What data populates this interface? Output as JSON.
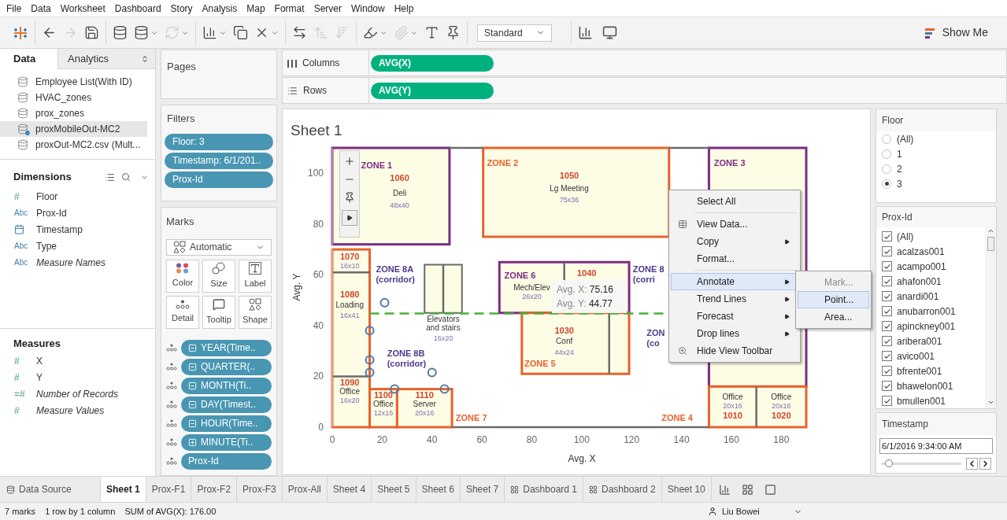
{
  "menu": [
    "File",
    "Data",
    "Worksheet",
    "Dashboard",
    "Story",
    "Analysis",
    "Map",
    "Format",
    "Server",
    "Window",
    "Help"
  ],
  "toolbar": {
    "buttons": [
      {
        "kind": "logo"
      },
      {
        "kind": "back",
        "disabled": false
      },
      {
        "kind": "forward",
        "disabled": true
      },
      {
        "kind": "save",
        "disabled": false
      },
      {
        "kind": "new-source",
        "disabled": false
      },
      {
        "kind": "pause",
        "disabled": false,
        "caret": true
      },
      {
        "kind": "refresh",
        "disabled": true,
        "caret": true
      },
      {
        "kind": "new-sheet",
        "disabled": false,
        "caret": true
      },
      {
        "kind": "duplicate",
        "disabled": false
      },
      {
        "kind": "clear",
        "disabled": false,
        "caret": true
      },
      {
        "kind": "swap",
        "disabled": false
      },
      {
        "kind": "sort-asc",
        "disabled": true
      },
      {
        "kind": "sort-desc",
        "disabled": true
      },
      {
        "kind": "highlight",
        "disabled": false,
        "caret": true
      },
      {
        "kind": "group",
        "disabled": true,
        "caret": true
      },
      {
        "kind": "labels",
        "disabled": false
      },
      {
        "kind": "pin",
        "disabled": false
      }
    ],
    "view_size": "Standard",
    "show_me": "Show Me"
  },
  "data_pane": {
    "tabs": [
      {
        "label": "Data",
        "selected": true
      },
      {
        "label": "Analytics",
        "selected": false
      }
    ],
    "sources": [
      {
        "name": "Employee List(With ID)",
        "selected": false
      },
      {
        "name": "HVAC_zones",
        "selected": false
      },
      {
        "name": "prox_zones",
        "selected": false
      },
      {
        "name": "proxMobileOut-MC2",
        "selected": true
      },
      {
        "name": "proxOut-MC2.csv (Mult...",
        "selected": false
      }
    ],
    "dimensions": {
      "title": "Dimensions",
      "fields": [
        {
          "kind": "number",
          "badge": "#",
          "name": "Floor",
          "generated": false
        },
        {
          "kind": "string",
          "badge": "Abc",
          "name": "Prox-Id",
          "generated": false
        },
        {
          "kind": "date",
          "name": "Timestamp",
          "generated": false
        },
        {
          "kind": "string",
          "badge": "Abc",
          "name": "Type",
          "generated": false
        },
        {
          "kind": "string",
          "badge": "Abc",
          "name": "Measure Names",
          "generated": true
        }
      ]
    },
    "measures": {
      "title": "Measures",
      "fields": [
        {
          "kind": "number",
          "badge": "#",
          "name": "X",
          "generated": false
        },
        {
          "kind": "number",
          "badge": "#",
          "name": "Y",
          "generated": false
        },
        {
          "kind": "number",
          "badge": "=#",
          "name": "Number of Records",
          "generated": true
        },
        {
          "kind": "number",
          "badge": "#",
          "name": "Measure Values",
          "generated": true
        }
      ]
    }
  },
  "pages": {
    "title": "Pages"
  },
  "filters": {
    "title": "Filters",
    "pills": [
      "Floor: 3",
      "Timestamp: 6/1/201..",
      "Prox-Id"
    ]
  },
  "marks": {
    "title": "Marks",
    "mark_type": "Automatic",
    "cards": [
      {
        "kind": "color",
        "label": "Color"
      },
      {
        "kind": "size",
        "label": "Size"
      },
      {
        "kind": "label",
        "label": "Label"
      },
      {
        "kind": "detail",
        "label": "Detail"
      },
      {
        "kind": "tooltip",
        "label": "Tooltip"
      },
      {
        "kind": "shape",
        "label": "Shape"
      }
    ],
    "pills": [
      {
        "label": "YEAR(Time..",
        "expanded": true
      },
      {
        "label": "QUARTER(..",
        "expanded": true
      },
      {
        "label": "MONTH(Ti..",
        "expanded": true
      },
      {
        "label": "DAY(Timest..",
        "expanded": true
      },
      {
        "label": "HOUR(Time..",
        "expanded": true
      },
      {
        "label": "MINUTE(Ti..",
        "expanded": false
      },
      {
        "label": "Prox-Id"
      }
    ]
  },
  "shelves": [
    {
      "kind": "columns",
      "label": "Columns",
      "pills": [
        "AVG(X)"
      ]
    },
    {
      "kind": "rows",
      "label": "Rows",
      "pills": [
        "AVG(Y)"
      ]
    }
  ],
  "sheet": {
    "title": "Sheet 1",
    "chart_data": {
      "type": "scatter",
      "xlabel": "Avg. X",
      "ylabel": "Avg. Y",
      "x": [
        21,
        15,
        15,
        15,
        25,
        40,
        45
      ],
      "series": [
        {
          "color": "#4e79a7",
          "values": [
            49,
            38,
            26.5,
            21.5,
            15,
            21.5,
            15
          ]
        }
      ],
      "xlim": [
        0,
        190
      ],
      "ylim": [
        0,
        110
      ],
      "xticks": [
        0,
        20,
        40,
        60,
        80,
        100,
        120,
        140,
        160,
        180
      ],
      "yticks": [
        0,
        20,
        40,
        60,
        80,
        100
      ],
      "ref_lines": [
        {
          "axis": "y",
          "value": 44.77
        }
      ]
    },
    "floor_plan_labels": [
      {
        "kind": "zone",
        "text": "ZONE 1",
        "color": "#7b2d83"
      },
      {
        "kind": "number",
        "text": "1060"
      },
      {
        "kind": "name",
        "text": "Deli"
      },
      {
        "kind": "size",
        "text": "48x40"
      },
      {
        "kind": "zone",
        "text": "ZONE 2",
        "color": "#e8622c"
      },
      {
        "kind": "number",
        "text": "1050"
      },
      {
        "kind": "name",
        "text": "Lg Meeting"
      },
      {
        "kind": "size",
        "text": "75x36"
      },
      {
        "kind": "zone",
        "text": "ZONE 3",
        "color": "#7b2d83"
      },
      {
        "kind": "number",
        "text": "1070"
      },
      {
        "kind": "size",
        "text": "16x10"
      },
      {
        "kind": "corridor",
        "text": "ZONE 8A"
      },
      {
        "kind": "corridor",
        "text": "(corridor)"
      },
      {
        "kind": "name",
        "text": "Elevators"
      },
      {
        "kind": "name",
        "text": "and stairs"
      },
      {
        "kind": "size",
        "text": "16x20"
      },
      {
        "kind": "zone",
        "text": "ZONE 6",
        "color": "#7b2d83"
      },
      {
        "kind": "name",
        "text": "Mech/Elev"
      },
      {
        "kind": "size",
        "text": "26x20"
      },
      {
        "kind": "number",
        "text": "1040"
      },
      {
        "kind": "corridor",
        "text": "ZONE 8"
      },
      {
        "kind": "corridor",
        "text": "(corri"
      },
      {
        "kind": "number",
        "text": "1080"
      },
      {
        "kind": "name",
        "text": "Loading"
      },
      {
        "kind": "size",
        "text": "16x41"
      },
      {
        "kind": "corridor",
        "text": "ZONE 8B"
      },
      {
        "kind": "corridor",
        "text": "(corridor)"
      },
      {
        "kind": "number",
        "text": "1030"
      },
      {
        "kind": "name",
        "text": "Conf"
      },
      {
        "kind": "size",
        "text": "44x24"
      },
      {
        "kind": "zone",
        "text": "ZONE 5",
        "color": "#e8622c"
      },
      {
        "kind": "corridor",
        "text": "ZON"
      },
      {
        "kind": "corridor",
        "text": "(co"
      },
      {
        "kind": "number",
        "text": "1090"
      },
      {
        "kind": "name",
        "text": "Office"
      },
      {
        "kind": "size",
        "text": "16x20"
      },
      {
        "kind": "number",
        "text": "1100"
      },
      {
        "kind": "name",
        "text": "Office"
      },
      {
        "kind": "size",
        "text": "12x16"
      },
      {
        "kind": "number",
        "text": "1110"
      },
      {
        "kind": "name",
        "text": "Server"
      },
      {
        "kind": "size",
        "text": "20x16"
      },
      {
        "kind": "zone",
        "text": "ZONE 7",
        "color": "#e8622c"
      },
      {
        "kind": "zone",
        "text": "ZONE 4",
        "color": "#e8622c"
      },
      {
        "kind": "name",
        "text": "Office"
      },
      {
        "kind": "size",
        "text": "20x16"
      },
      {
        "kind": "number",
        "text": "1010"
      },
      {
        "kind": "name",
        "text": "Office"
      },
      {
        "kind": "size",
        "text": "20x16"
      },
      {
        "kind": "number",
        "text": "1020"
      }
    ],
    "tooltip": [
      {
        "label": "Avg. X:",
        "value": "75.16"
      },
      {
        "label": "Avg. Y:",
        "value": "44.77"
      }
    ],
    "context_menu": [
      {
        "kind": "item",
        "label": "Select All",
        "submenu": false,
        "selected": false
      },
      {
        "kind": "separator"
      },
      {
        "kind": "item",
        "label": "View Data...",
        "submenu": false,
        "selected": false
      },
      {
        "kind": "item",
        "label": "Copy",
        "submenu": true,
        "selected": false
      },
      {
        "kind": "item",
        "label": "Format...",
        "submenu": false,
        "selected": false
      },
      {
        "kind": "separator"
      },
      {
        "kind": "item",
        "label": "Annotate",
        "submenu": true,
        "selected": true
      },
      {
        "kind": "item",
        "label": "Trend Lines",
        "submenu": true,
        "selected": false
      },
      {
        "kind": "item",
        "label": "Forecast",
        "submenu": true,
        "selected": false
      },
      {
        "kind": "item",
        "label": "Drop lines",
        "submenu": true,
        "selected": false
      },
      {
        "kind": "item",
        "label": "Hide View Toolbar",
        "submenu": false,
        "selected": false
      }
    ],
    "submenu": [
      {
        "label": "Mark...",
        "disabled": true,
        "selected": false
      },
      {
        "label": "Point...",
        "disabled": false,
        "selected": true
      },
      {
        "label": "Area...",
        "disabled": false,
        "selected": false
      }
    ]
  },
  "floor_filter": {
    "title": "Floor",
    "options": [
      {
        "label": "(All)",
        "selected": false
      },
      {
        "label": "1",
        "selected": false
      },
      {
        "label": "2",
        "selected": false
      },
      {
        "label": "3",
        "selected": true
      }
    ]
  },
  "prox_filter": {
    "title": "Prox-Id",
    "items": [
      {
        "label": "(All)",
        "checked": true
      },
      {
        "label": "acalzas001",
        "checked": true
      },
      {
        "label": "acampo001",
        "checked": true
      },
      {
        "label": "ahafon001",
        "checked": true
      },
      {
        "label": "anardi001",
        "checked": true
      },
      {
        "label": "anubarron001",
        "checked": true
      },
      {
        "label": "apinckney001",
        "checked": true
      },
      {
        "label": "aribera001",
        "checked": true
      },
      {
        "label": "avico001",
        "checked": true
      },
      {
        "label": "bfrente001",
        "checked": true
      },
      {
        "label": "bhawelon001",
        "checked": true
      },
      {
        "label": "bmullen001",
        "checked": true
      }
    ]
  },
  "timestamp_filter": {
    "title": "Timestamp",
    "value": "6/1/2016 9:34:00 AM",
    "level": 0.1
  },
  "sheet_tabs": [
    {
      "kind": "datasource",
      "label": "Data Source",
      "selected": false
    },
    {
      "kind": "sheet",
      "label": "Sheet 1",
      "selected": true
    },
    {
      "kind": "sheet",
      "label": "Prox-F1",
      "selected": false
    },
    {
      "kind": "sheet",
      "label": "Prox-F2",
      "selected": false
    },
    {
      "kind": "sheet",
      "label": "Prox-F3",
      "selected": false
    },
    {
      "kind": "sheet",
      "label": "Prox-All",
      "selected": false
    },
    {
      "kind": "sheet",
      "label": "Sheet 4",
      "selected": false
    },
    {
      "kind": "sheet",
      "label": "Sheet 5",
      "selected": false
    },
    {
      "kind": "sheet",
      "label": "Sheet 6",
      "selected": false
    },
    {
      "kind": "sheet",
      "label": "Sheet 7",
      "selected": false
    },
    {
      "kind": "dashboard",
      "label": "Dashboard 1",
      "selected": false
    },
    {
      "kind": "dashboard",
      "label": "Dashboard 2",
      "selected": false
    },
    {
      "kind": "sheet",
      "label": "Sheet 10",
      "selected": false
    }
  ],
  "status_bar": {
    "items": [
      "7 marks",
      "1 row by 1 column",
      "SUM of AVG(X): 176.00"
    ],
    "user": "Liu Bowei"
  }
}
